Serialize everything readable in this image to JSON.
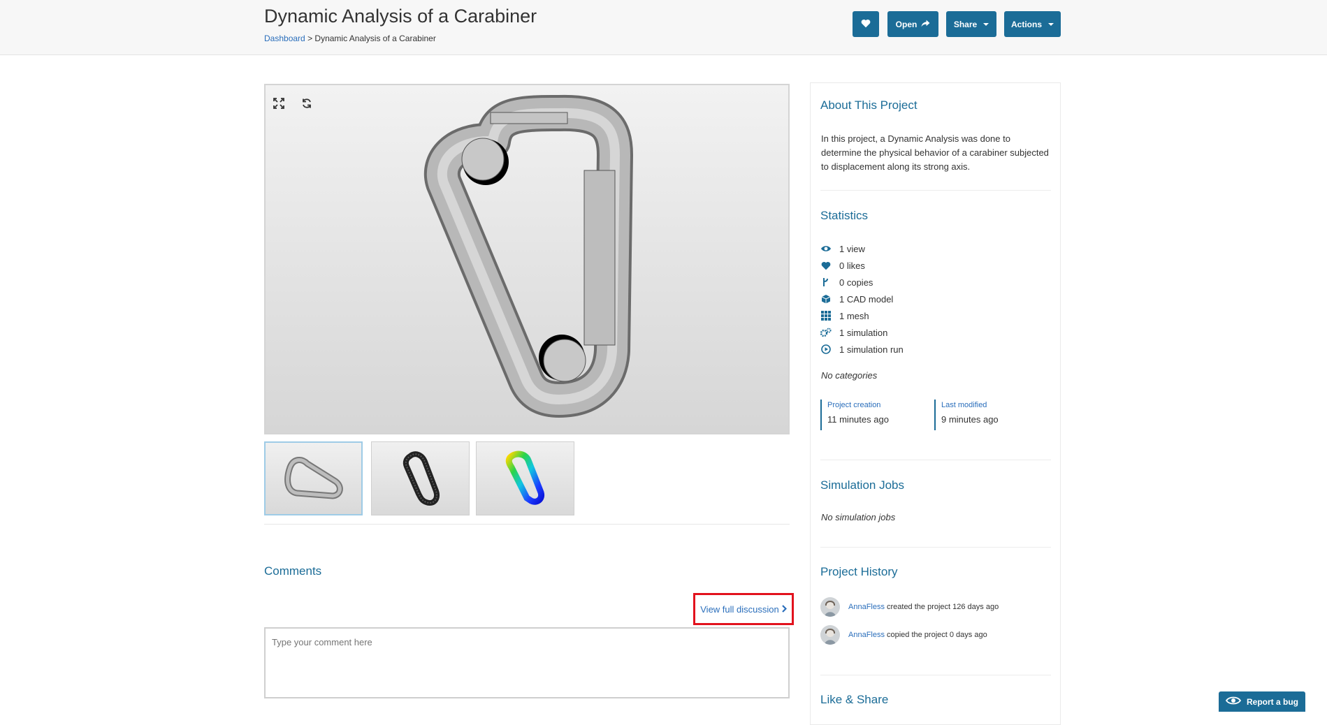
{
  "header": {
    "title": "Dynamic Analysis of a Carabiner",
    "breadcrumb": {
      "root": "Dashboard",
      "separator": ">",
      "current": "Dynamic Analysis of a Carabiner"
    },
    "buttons": {
      "open": "Open",
      "share": "Share",
      "actions": "Actions"
    }
  },
  "viewer": {
    "tools": [
      "fullscreen-icon",
      "reset-view-icon"
    ],
    "thumbnails": [
      "cad-model-thumbnail",
      "mesh-thumbnail",
      "simulation-result-thumbnail"
    ]
  },
  "comments": {
    "title": "Comments",
    "view_full_discussion": "View full discussion",
    "placeholder": "Type your comment here"
  },
  "sidebar": {
    "about": {
      "title": "About This Project",
      "description": "In this project, a Dynamic Analysis was done to determine the physical behavior of a carabiner subjected to displacement along its strong axis."
    },
    "statistics": {
      "title": "Statistics",
      "items": [
        {
          "icon": "eye-icon",
          "label": "1 view"
        },
        {
          "icon": "heart-icon",
          "label": "0 likes"
        },
        {
          "icon": "fork-icon",
          "label": "0 copies"
        },
        {
          "icon": "cube-icon",
          "label": "1 CAD model"
        },
        {
          "icon": "grid-icon",
          "label": "1 mesh"
        },
        {
          "icon": "gears-icon",
          "label": "1 simulation"
        },
        {
          "icon": "play-icon",
          "label": "1 simulation run"
        }
      ],
      "categories": "No categories",
      "project_creation_label": "Project creation",
      "project_creation_value": "11 minutes ago",
      "last_modified_label": "Last modified",
      "last_modified_value": "9 minutes ago"
    },
    "simulation_jobs": {
      "title": "Simulation Jobs",
      "empty": "No simulation jobs"
    },
    "history": {
      "title": "Project History",
      "items": [
        {
          "user": "AnnaFless",
          "action": "created the project 126 days ago"
        },
        {
          "user": "AnnaFless",
          "action": "copied the project 0 days ago"
        }
      ]
    },
    "like_share": {
      "title": "Like & Share"
    }
  },
  "report_bug": "Report a bug",
  "colors": {
    "primary": "#1b6c97",
    "link": "#2a6ebb",
    "highlight_border": "#e2121d"
  }
}
